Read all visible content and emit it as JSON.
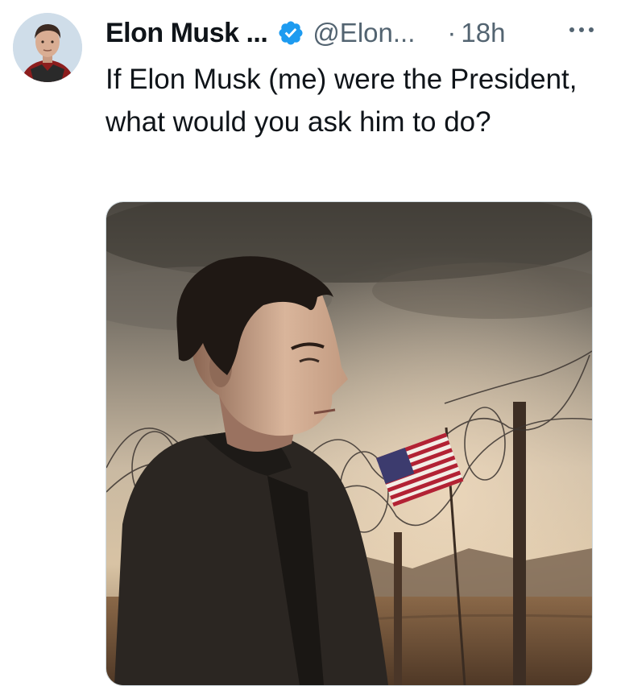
{
  "tweet": {
    "author_name": "Elon Musk ...",
    "handle": "@Elon...",
    "separator": "·",
    "time": "18h",
    "text": "If Elon Musk (me) were the President, what would you ask him to do?",
    "icons": {
      "verified": "verified-badge-icon",
      "more": "more-options-icon"
    },
    "colors": {
      "verified": "#1d9bf0",
      "secondary_text": "#536471",
      "primary_text": "#0f1419"
    }
  }
}
